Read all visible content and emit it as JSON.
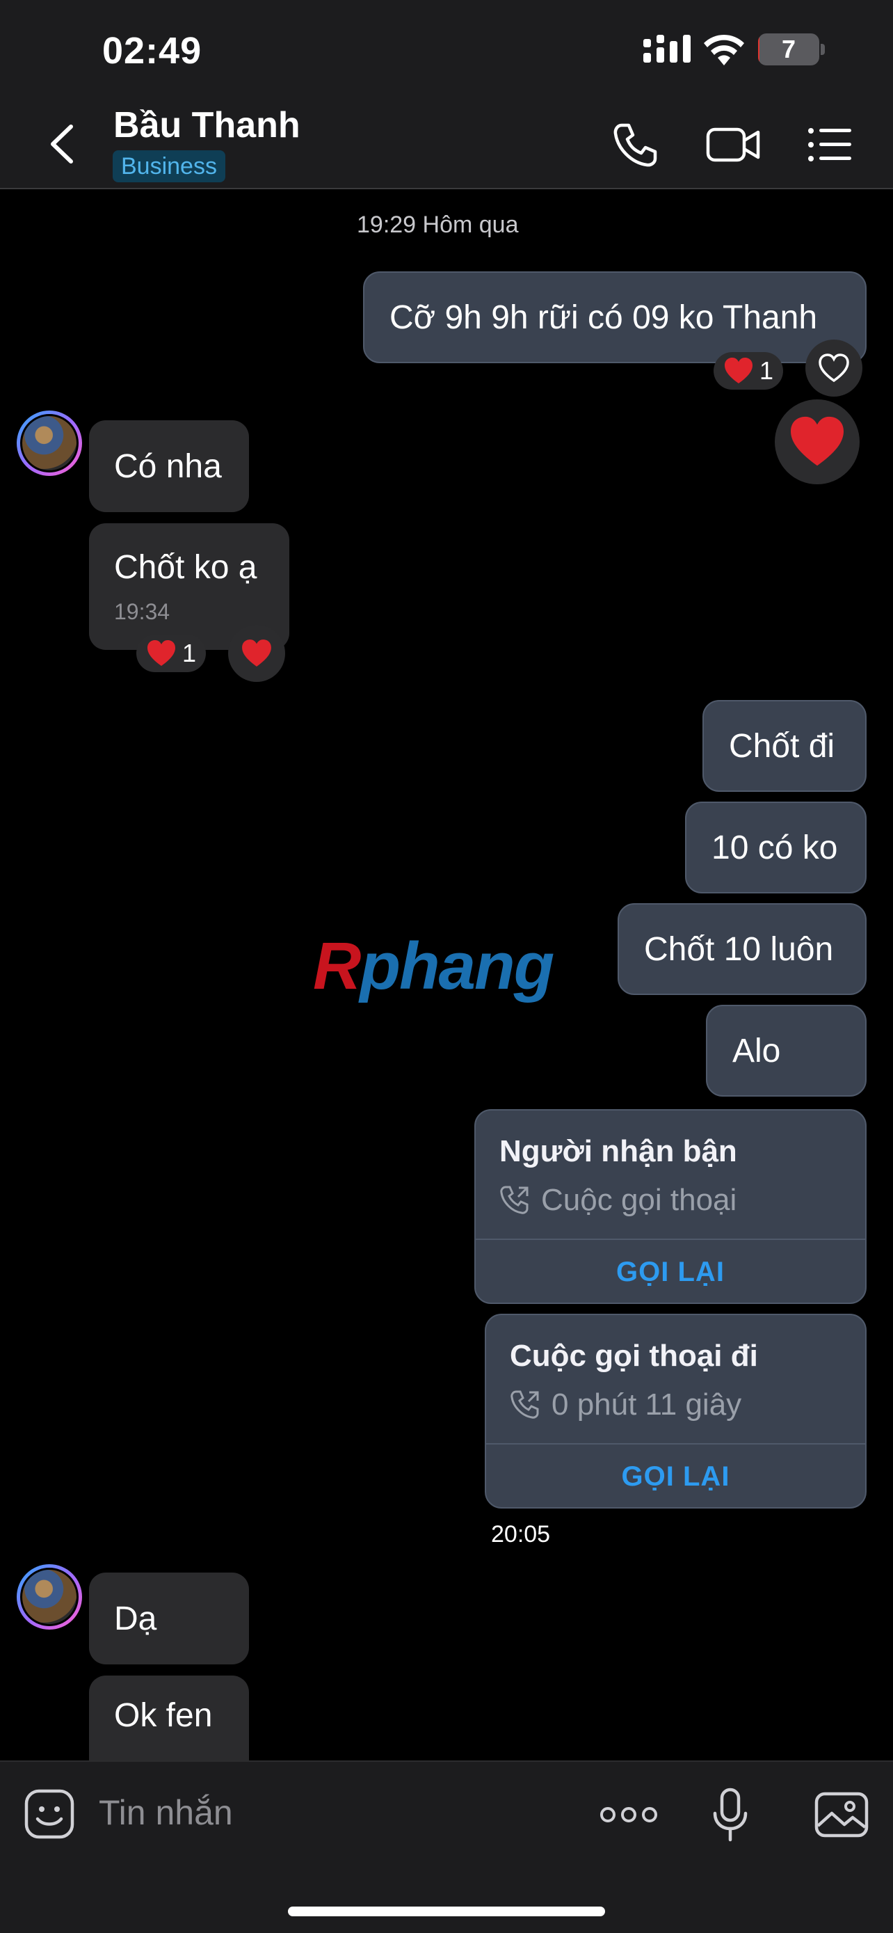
{
  "status_bar": {
    "time": "02:49",
    "battery_level": "7",
    "battery_fraction": 0.07
  },
  "header": {
    "contact_name": "Bầu Thanh",
    "badge": "Business",
    "icons": [
      "back-chevron-icon",
      "phone-icon",
      "video-icon",
      "menu-list-icon"
    ]
  },
  "chat": {
    "timestamp_top": "19:29 Hôm qua",
    "sent_1": "Cỡ 9h 9h rữi có 09 ko Thanh",
    "sent_1_reaction_count": "1",
    "recv_1": "Có nha",
    "recv_2": "Chốt ko ạ",
    "recv_2_time": "19:34",
    "recv_2_reaction_count": "1",
    "sent_2": "Chốt đi",
    "sent_3": "10 có ko",
    "sent_4": "Chốt 10 luôn",
    "sent_5": "Alo",
    "call_1": {
      "title": "Người nhận bận",
      "detail": "Cuộc gọi thoại",
      "action": "GỌI LẠI"
    },
    "call_2": {
      "title": "Cuộc gọi thoại đi",
      "detail": "0 phút 11 giây",
      "action": "GỌI LẠI"
    },
    "timestamp_2": "20:05",
    "recv_3": "Dạ",
    "recv_4": "Ok fen",
    "watermark_r": "R",
    "watermark_rest": "phang"
  },
  "composer": {
    "placeholder": "Tin nhắn"
  },
  "colors": {
    "sent_bubble": "#3a4250",
    "recv_bubble": "#2b2b2d",
    "accent": "#2d9bf0",
    "heart": "#e0242c"
  }
}
